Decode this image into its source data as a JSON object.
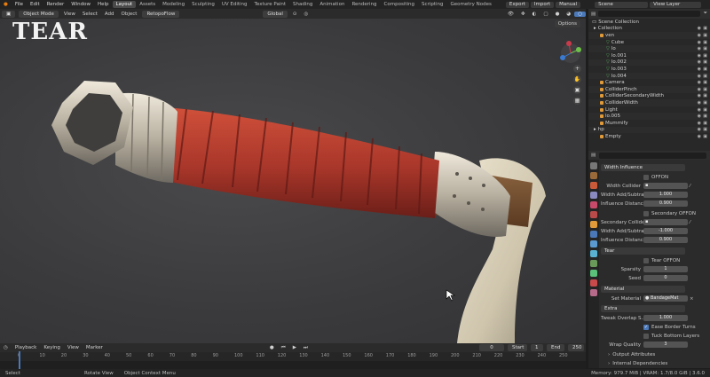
{
  "topbar": {
    "menus": [
      "File",
      "Edit",
      "Render",
      "Window",
      "Help"
    ],
    "workspaces": [
      "Layout",
      "Assets",
      "Modeling",
      "Sculpting",
      "UV Editing",
      "Texture Paint",
      "Shading",
      "Animation",
      "Rendering",
      "Compositing",
      "Scripting",
      "Geometry Nodes"
    ],
    "active_workspace": "Layout",
    "buttons": [
      "Export",
      "Import",
      "Manual"
    ],
    "scene_label": "Scene",
    "view_layer_label": "View Layer"
  },
  "viewport_header": {
    "mode": "Object Mode",
    "menus": [
      "View",
      "Select",
      "Add",
      "Object"
    ],
    "addon": "RetopoFlow",
    "orientation": "Global",
    "options_label": "Options"
  },
  "overlay_title": "TEAR",
  "outliner": {
    "header": "Scene Collection",
    "rows": [
      {
        "label": "Collection",
        "depth": 0
      },
      {
        "label": "ven",
        "depth": 1
      },
      {
        "label": "Cube",
        "depth": 2
      },
      {
        "label": "lo",
        "depth": 2
      },
      {
        "label": "lo.001",
        "depth": 2
      },
      {
        "label": "lo.002",
        "depth": 2
      },
      {
        "label": "lo.003",
        "depth": 2
      },
      {
        "label": "lo.004",
        "depth": 2
      },
      {
        "label": "Camera",
        "depth": 1
      },
      {
        "label": "ColliderPinch",
        "depth": 1
      },
      {
        "label": "ColliderSecondaryWidth",
        "depth": 1
      },
      {
        "label": "ColliderWidth",
        "depth": 1
      },
      {
        "label": "Light",
        "depth": 1
      },
      {
        "label": "lo.005",
        "depth": 1
      },
      {
        "label": "Mummify",
        "depth": 1
      },
      {
        "label": "hp",
        "depth": 0
      },
      {
        "label": "Empty",
        "depth": 1
      }
    ]
  },
  "properties": {
    "width_influence_header": "Width Influence",
    "offon_label": "OFFON",
    "width_collider_label": "Width Collider",
    "width_add_label": "Width Add/Subtract",
    "width_add_value": "1.000",
    "influence_distance_label": "Influence Distance",
    "influence_distance_value": "0.900",
    "secondary_offon_label": "Secondary OFFON",
    "secondary_collider_label": "Secondary Collider",
    "secondary_width_add_label": "Width Add/Subtract",
    "secondary_width_add_value": "-1.000",
    "secondary_influence_label": "Influence Distance",
    "secondary_influence_value": "0.900",
    "tear_header": "Tear",
    "tear_offon_label": "Tear OFFON",
    "sparsity_label": "Sparsity",
    "sparsity_value": "1",
    "seed_label": "Seed",
    "seed_value": "0",
    "material_header": "Material",
    "set_material_label": "Set Material",
    "set_material_value": "BandageMat",
    "extra_header": "Extra",
    "tweak_overlap_label": "Tweak Overlap S...",
    "tweak_overlap_value": "1.000",
    "ease_border_label": "Ease Border Turns",
    "tuck_bottom_label": "Tuck Bottom Layers",
    "wrap_quality_label": "Wrap Quality",
    "wrap_quality_value": "3",
    "output_attributes_label": "Output Attributes",
    "internal_dependencies_label": "Internal Dependencies"
  },
  "timeline": {
    "menus": [
      "Playback",
      "Keying",
      "View",
      "Marker"
    ],
    "current_frame": "0",
    "start_label": "Start",
    "start_value": "1",
    "end_label": "End",
    "end_value": "250",
    "ticks": [
      "0",
      "10",
      "20",
      "30",
      "40",
      "50",
      "60",
      "70",
      "80",
      "90",
      "100",
      "110",
      "120",
      "130",
      "140",
      "150",
      "160",
      "170",
      "180",
      "190",
      "200",
      "210",
      "220",
      "230",
      "240",
      "250"
    ]
  },
  "statusbar": {
    "select": "Select",
    "rotate": "Rotate View",
    "context": "Object Context Menu",
    "memory": "Memory: 979.7 MiB | VRAM: 1.7/8.0 GiB | 3.6.0"
  },
  "colors": {
    "accent_blue": "#4a78b8",
    "header_bg": "#2b2b2b",
    "viewport_bg": "#3a3a3c",
    "wrap_red": "#b13a2c",
    "metal": "#c8c0b0"
  }
}
